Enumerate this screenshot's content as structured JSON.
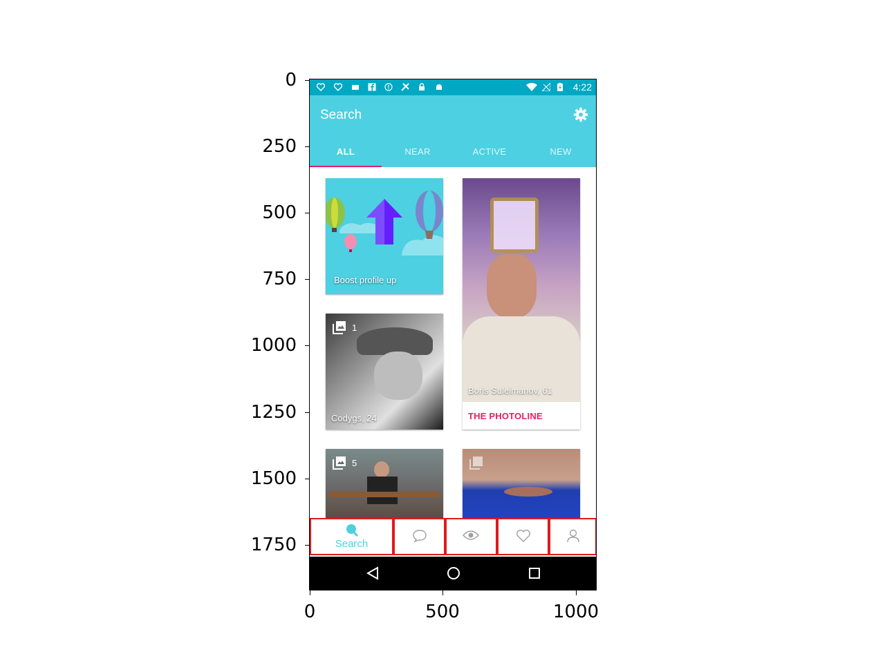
{
  "axes": {
    "y_ticks": [
      "0",
      "250",
      "500",
      "750",
      "1000",
      "1250",
      "1500",
      "1750"
    ],
    "x_ticks": [
      "0",
      "500",
      "1000"
    ]
  },
  "status_bar": {
    "time": "4:22",
    "icons": [
      "heart-monitor-icon",
      "heart-monitor-icon",
      "mail-icon",
      "facebook-icon",
      "info-icon",
      "tools-icon",
      "lock-icon",
      "android-icon",
      "wifi-icon",
      "no-signal-icon",
      "battery-charging-icon"
    ]
  },
  "app_bar": {
    "title": "Search",
    "settings_icon": "gear-icon",
    "tabs": [
      {
        "label": "ALL",
        "active": true
      },
      {
        "label": "NEAR",
        "active": false
      },
      {
        "label": "ACTIVE",
        "active": false
      },
      {
        "label": "NEW",
        "active": false
      }
    ],
    "accent_color": "#4dd0e1",
    "indicator_color": "#e91e63"
  },
  "grid": {
    "boost_card": {
      "label": "Boost profile up"
    },
    "profiles": [
      {
        "name_age": "Codygs, 24",
        "photo_count": "1"
      },
      {
        "name_age": "Boris Suleimanov, 61",
        "tag": "THE PHOTOLINE"
      },
      {
        "photo_count": "5"
      },
      {
        "photo_count": ""
      }
    ]
  },
  "bottom_nav": {
    "items": [
      {
        "icon": "search-icon",
        "label": "Search",
        "active": true
      },
      {
        "icon": "chat-icon",
        "label": ""
      },
      {
        "icon": "eye-icon",
        "label": ""
      },
      {
        "icon": "heart-icon",
        "label": ""
      },
      {
        "icon": "person-icon",
        "label": ""
      }
    ]
  },
  "system_nav": {
    "icons": [
      "back-icon",
      "home-icon",
      "recents-icon"
    ]
  }
}
